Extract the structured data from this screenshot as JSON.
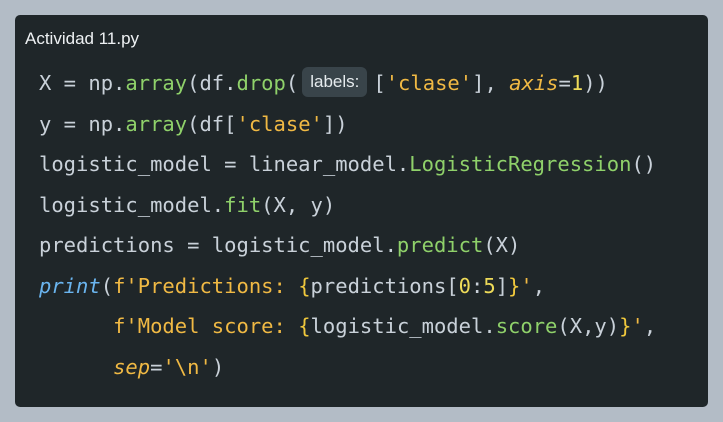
{
  "window": {
    "title": "Actividad 11.py"
  },
  "editor": {
    "inlay_hint": "labels:",
    "colors": {
      "background": "#1f2629",
      "page": "#b3bcc6",
      "default_text": "#c9d1d9",
      "function": "#8fd16a",
      "string": "#f0b944",
      "number": "#eedb59",
      "builtin": "#6ab4ee"
    },
    "lines": [
      {
        "tokens": [
          {
            "text": "X = np.",
            "style": "plain"
          },
          {
            "text": "array",
            "style": "fn"
          },
          {
            "text": "(df.",
            "style": "plain"
          },
          {
            "text": "drop",
            "style": "fn"
          },
          {
            "text": "(",
            "style": "plain"
          },
          {
            "text": "labels:",
            "style": "hint"
          },
          {
            "text": "[",
            "style": "plain"
          },
          {
            "text": "'clase'",
            "style": "str"
          },
          {
            "text": "], ",
            "style": "plain"
          },
          {
            "text": "axis",
            "style": "kw"
          },
          {
            "text": "=",
            "style": "plain"
          },
          {
            "text": "1",
            "style": "num"
          },
          {
            "text": "))",
            "style": "plain"
          }
        ]
      },
      {
        "tokens": [
          {
            "text": "y = np.",
            "style": "plain"
          },
          {
            "text": "array",
            "style": "fn"
          },
          {
            "text": "(df[",
            "style": "plain"
          },
          {
            "text": "'clase'",
            "style": "str"
          },
          {
            "text": "])",
            "style": "plain"
          }
        ]
      },
      {
        "tokens": [
          {
            "text": "logistic_model = linear_model.",
            "style": "plain"
          },
          {
            "text": "LogisticRegression",
            "style": "fn"
          },
          {
            "text": "()",
            "style": "plain"
          }
        ]
      },
      {
        "tokens": [
          {
            "text": "logistic_model.",
            "style": "plain"
          },
          {
            "text": "fit",
            "style": "fn"
          },
          {
            "text": "(X, y)",
            "style": "plain"
          }
        ]
      },
      {
        "tokens": [
          {
            "text": "predictions = logistic_model.",
            "style": "plain"
          },
          {
            "text": "predict",
            "style": "fn"
          },
          {
            "text": "(X)",
            "style": "plain"
          }
        ]
      },
      {
        "tokens": [
          {
            "text": "print",
            "style": "bi"
          },
          {
            "text": "(",
            "style": "plain"
          },
          {
            "text": "f'Predictions: ",
            "style": "str"
          },
          {
            "text": "{",
            "style": "br"
          },
          {
            "text": "predictions[",
            "style": "plain"
          },
          {
            "text": "0",
            "style": "num"
          },
          {
            "text": ":",
            "style": "plain"
          },
          {
            "text": "5",
            "style": "num"
          },
          {
            "text": "]",
            "style": "plain"
          },
          {
            "text": "}",
            "style": "br"
          },
          {
            "text": "'",
            "style": "str"
          },
          {
            "text": ",",
            "style": "plain"
          }
        ]
      },
      {
        "tokens": [
          {
            "text": "      ",
            "style": "plain"
          },
          {
            "text": "f'Model score: ",
            "style": "str"
          },
          {
            "text": "{",
            "style": "br"
          },
          {
            "text": "logistic_model.",
            "style": "plain"
          },
          {
            "text": "score",
            "style": "fn"
          },
          {
            "text": "(X,y)",
            "style": "plain"
          },
          {
            "text": "}",
            "style": "br"
          },
          {
            "text": "'",
            "style": "str"
          },
          {
            "text": ",",
            "style": "plain"
          }
        ]
      },
      {
        "tokens": [
          {
            "text": "      ",
            "style": "plain"
          },
          {
            "text": "sep",
            "style": "kw"
          },
          {
            "text": "=",
            "style": "plain"
          },
          {
            "text": "'\\n'",
            "style": "str"
          },
          {
            "text": ")",
            "style": "plain"
          }
        ]
      }
    ]
  }
}
